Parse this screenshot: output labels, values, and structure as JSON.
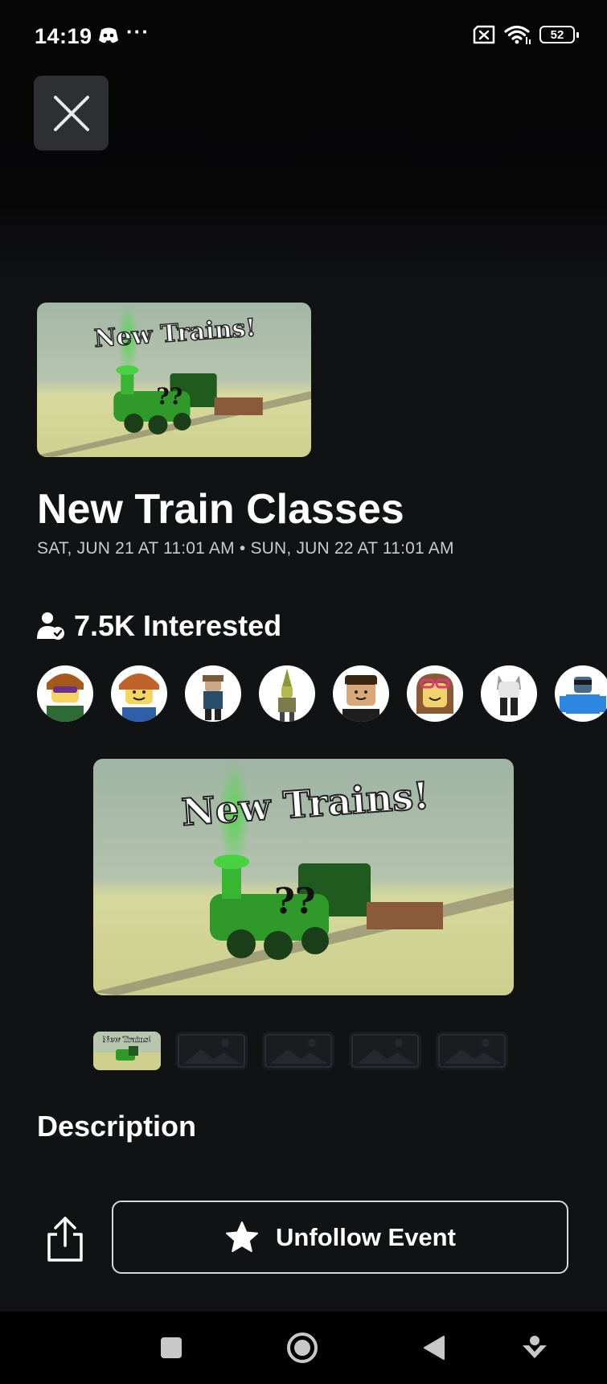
{
  "status_bar": {
    "time": "14:19",
    "more": "···",
    "battery_level": "52",
    "icons": [
      "discord-icon",
      "sim-missing-icon",
      "wifi-icon",
      "battery-icon"
    ]
  },
  "header": {
    "close_icon": "close-icon"
  },
  "event": {
    "image_text": "New Trains!",
    "image_mark": "??",
    "title": "New Train Classes",
    "dates": "SAT, JUN 21 AT 11:01 AM • SUN, JUN 22 AT 11:01 AM",
    "interested_label": "7.5K Interested",
    "interested_icon": "person-check-icon",
    "avatar_count_visible": 8
  },
  "media": {
    "main_text": "New Trains!",
    "main_mark": "??",
    "thumbnails": [
      {
        "type": "image",
        "text": "New Trains!",
        "active": true
      },
      {
        "type": "placeholder"
      },
      {
        "type": "placeholder"
      },
      {
        "type": "placeholder"
      },
      {
        "type": "placeholder"
      }
    ]
  },
  "description": {
    "heading": "Description"
  },
  "actions": {
    "share_icon": "share-icon",
    "unfollow_label": "Unfollow Event",
    "unfollow_icon": "star-icon"
  },
  "nav_bar": {
    "items": [
      "recents-icon",
      "home-icon",
      "back-icon",
      "assistant-icon"
    ]
  },
  "colors": {
    "background": "#111214",
    "close_button_bg": "#2d2f33",
    "text_primary": "#ffffff",
    "text_secondary": "#c9cacc",
    "train_green": "#2f9a2a"
  }
}
